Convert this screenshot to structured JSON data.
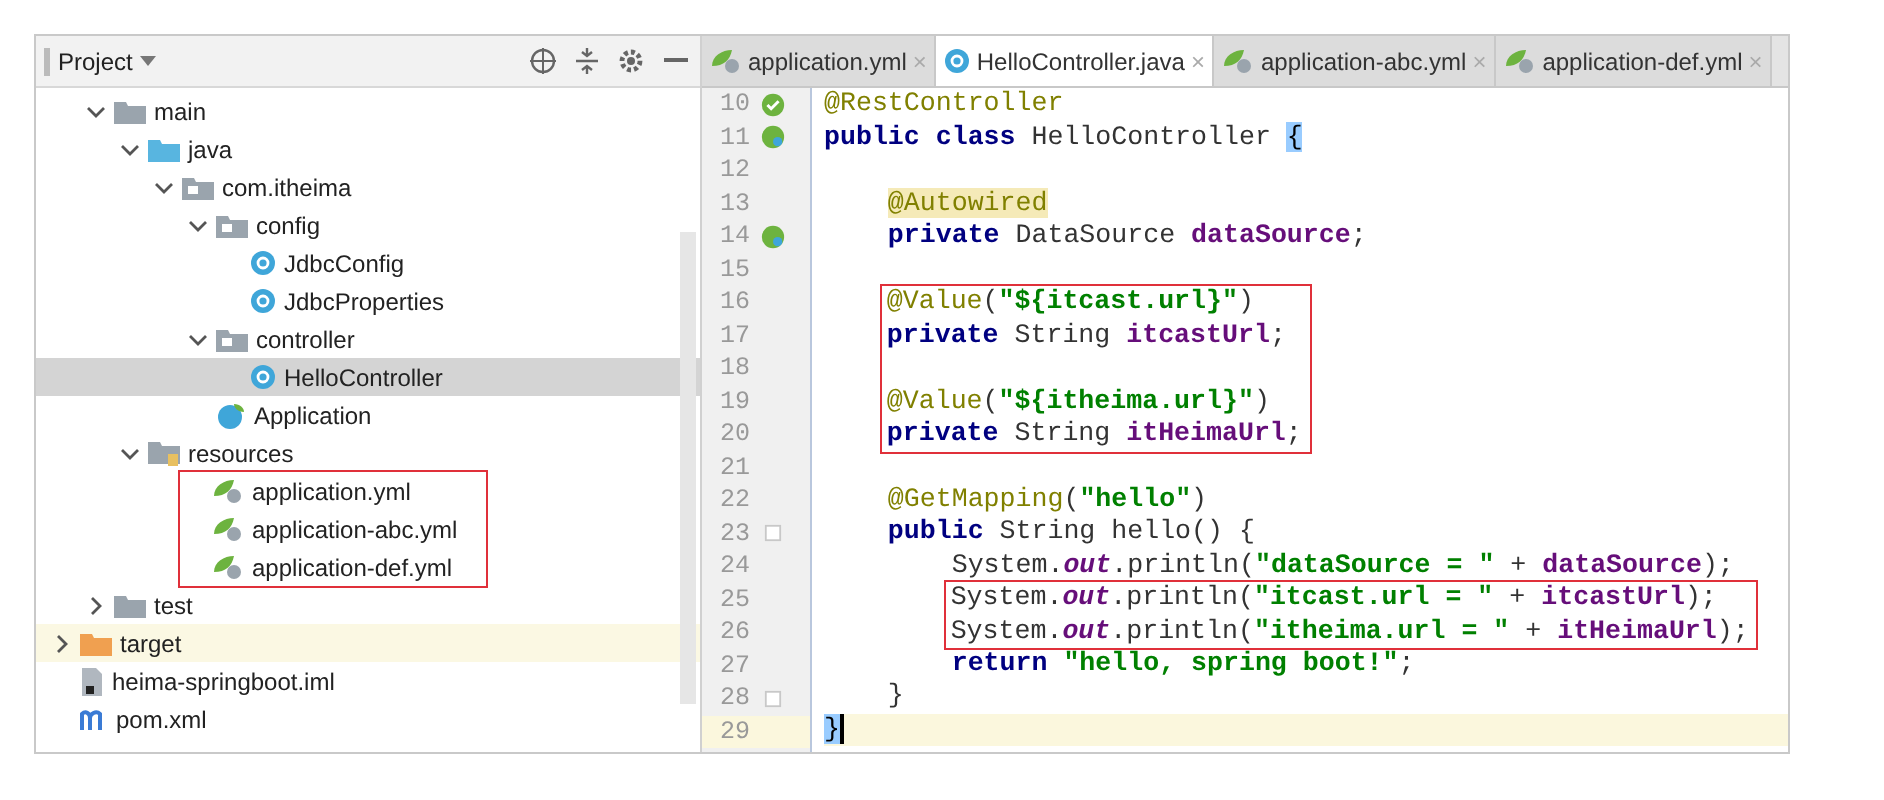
{
  "project_panel": {
    "title": "Project",
    "nested_items": [
      {
        "label": "main",
        "kind": "folder",
        "expanded": true,
        "selected": false,
        "children": [
          {
            "label": "java",
            "kind": "source-folder",
            "expanded": true,
            "selected": false,
            "children": [
              {
                "label": "com.itheima",
                "kind": "package",
                "expanded": true,
                "selected": false,
                "children": [
                  {
                    "label": "config",
                    "kind": "package",
                    "expanded": true,
                    "selected": false,
                    "children": [
                      {
                        "label": "JdbcConfig",
                        "kind": "class",
                        "selected": false
                      },
                      {
                        "label": "JdbcProperties",
                        "kind": "class",
                        "selected": false
                      }
                    ]
                  },
                  {
                    "label": "controller",
                    "kind": "package",
                    "expanded": true,
                    "selected": false,
                    "children": [
                      {
                        "label": "HelloController",
                        "kind": "class",
                        "selected": true
                      }
                    ]
                  },
                  {
                    "label": "Application",
                    "kind": "spring-class",
                    "selected": false
                  }
                ]
              }
            ]
          },
          {
            "label": "resources",
            "kind": "resources-folder",
            "expanded": true,
            "selected": false,
            "children": [
              {
                "kind": "box",
                "children": [
                  {
                    "label": "application.yml",
                    "kind": "yml",
                    "selected": false
                  },
                  {
                    "label": "application-abc.yml",
                    "kind": "yml",
                    "selected": false
                  },
                  {
                    "label": "application-def.yml",
                    "kind": "yml",
                    "selected": false
                  }
                ]
              }
            ]
          }
        ]
      },
      {
        "label": "test",
        "kind": "folder",
        "expanded": false,
        "selected": false
      }
    ],
    "items": [
      {
        "label": "target",
        "kind": "excluded-folder",
        "expanded": false,
        "selected": false
      },
      {
        "label": "heima-springboot.iml",
        "kind": "iml",
        "selected": false
      },
      {
        "label": "pom.xml",
        "kind": "maven",
        "selected": false
      }
    ]
  },
  "tabs": [
    {
      "label": "application.yml",
      "kind": "yml",
      "selected": false
    },
    {
      "label": "HelloController.java",
      "kind": "class",
      "selected": true
    },
    {
      "label": "application-abc.yml",
      "kind": "yml",
      "selected": false
    },
    {
      "label": "application-def.yml",
      "kind": "yml",
      "selected": false
    }
  ],
  "close_glyph": "×",
  "editor": {
    "lines": [
      {
        "no": "10",
        "kind": "bean-check",
        "current": false,
        "tokens": [
          {
            "kind": "ann",
            "text": "@RestController"
          }
        ]
      },
      {
        "no": "11",
        "kind": "bean",
        "current": false,
        "tokens": [
          {
            "kind": "kw",
            "text": "public class "
          },
          {
            "kind": "plain",
            "text": "HelloController "
          },
          {
            "kind": "brace",
            "text": "{"
          }
        ]
      },
      {
        "no": "12",
        "current": false
      },
      {
        "no": "13",
        "current": false,
        "tokens": [
          {
            "kind": "ann-hl",
            "text": "    @Autowired"
          }
        ]
      },
      {
        "no": "14",
        "kind": "bean",
        "current": false,
        "tokens": [
          {
            "kind": "kw",
            "text": "    private "
          },
          {
            "kind": "plain",
            "text": "DataSource "
          },
          {
            "kind": "field",
            "text": "dataSource"
          },
          {
            "kind": "plain",
            "text": ";"
          }
        ]
      },
      {
        "no": "15",
        "current": false
      },
      {
        "kind": "box",
        "lines": [
          {
            "no": "16",
            "current": false,
            "tokens": [
              {
                "kind": "ann",
                "text": "    @Value"
              },
              {
                "kind": "plain",
                "text": "("
              },
              {
                "kind": "str",
                "text": "\"${itcast.url}\""
              },
              {
                "kind": "plain",
                "text": ")"
              }
            ]
          },
          {
            "no": "17",
            "current": false,
            "tokens": [
              {
                "kind": "kw",
                "text": "    private "
              },
              {
                "kind": "plain",
                "text": "String "
              },
              {
                "kind": "field",
                "text": "itcastUrl"
              },
              {
                "kind": "plain",
                "text": ";"
              }
            ]
          },
          {
            "no": "18",
            "current": false
          },
          {
            "no": "19",
            "current": false,
            "tokens": [
              {
                "kind": "ann",
                "text": "    @Value"
              },
              {
                "kind": "plain",
                "text": "("
              },
              {
                "kind": "str",
                "text": "\"${itheima.url}\""
              },
              {
                "kind": "plain",
                "text": ")"
              }
            ]
          },
          {
            "no": "20",
            "current": false,
            "tokens": [
              {
                "kind": "kw",
                "text": "    private "
              },
              {
                "kind": "plain",
                "text": "String "
              },
              {
                "kind": "field",
                "text": "itHeimaUrl"
              },
              {
                "kind": "plain",
                "text": ";"
              }
            ]
          }
        ]
      },
      {
        "no": "21",
        "current": false
      },
      {
        "no": "22",
        "current": false,
        "tokens": [
          {
            "kind": "ann",
            "text": "    @GetMapping"
          },
          {
            "kind": "plain",
            "text": "("
          },
          {
            "kind": "str",
            "text": "\"hello\""
          },
          {
            "kind": "plain",
            "text": ")"
          }
        ]
      },
      {
        "no": "23",
        "kind": "fold",
        "current": false,
        "tokens": [
          {
            "kind": "kw",
            "text": "    public "
          },
          {
            "kind": "plain",
            "text": "String hello() {"
          }
        ]
      },
      {
        "no": "24",
        "current": false,
        "tokens": [
          {
            "kind": "plain",
            "text": "        System."
          },
          {
            "kind": "static",
            "text": "out"
          },
          {
            "kind": "plain",
            "text": ".println("
          },
          {
            "kind": "str",
            "text": "\"dataSource = \""
          },
          {
            "kind": "plain",
            "text": " + "
          },
          {
            "kind": "field",
            "text": "dataSource"
          },
          {
            "kind": "plain",
            "text": ");"
          }
        ]
      },
      {
        "kind": "box",
        "lines": [
          {
            "no": "25",
            "current": false,
            "tokens": [
              {
                "kind": "plain",
                "text": "        System."
              },
              {
                "kind": "static",
                "text": "out"
              },
              {
                "kind": "plain",
                "text": ".println("
              },
              {
                "kind": "str",
                "text": "\"itcast.url = \""
              },
              {
                "kind": "plain",
                "text": " + "
              },
              {
                "kind": "field",
                "text": "itcastUrl"
              },
              {
                "kind": "plain",
                "text": ");"
              }
            ]
          },
          {
            "no": "26",
            "current": false,
            "tokens": [
              {
                "kind": "plain",
                "text": "        System."
              },
              {
                "kind": "static",
                "text": "out"
              },
              {
                "kind": "plain",
                "text": ".println("
              },
              {
                "kind": "str",
                "text": "\"itheima.url = \""
              },
              {
                "kind": "plain",
                "text": " + "
              },
              {
                "kind": "field",
                "text": "itHeimaUrl"
              },
              {
                "kind": "plain",
                "text": ");"
              }
            ]
          }
        ]
      },
      {
        "no": "27",
        "current": false,
        "tokens": [
          {
            "kind": "kw",
            "text": "        return "
          },
          {
            "kind": "str",
            "text": "\"hello, spring boot!\""
          },
          {
            "kind": "plain",
            "text": ";"
          }
        ]
      },
      {
        "no": "28",
        "kind": "fold",
        "current": false,
        "tokens": [
          {
            "kind": "plain",
            "text": "    }"
          }
        ]
      },
      {
        "no": "29",
        "current": true,
        "tokens": [
          {
            "kind": "brace",
            "text": "}"
          }
        ]
      }
    ]
  }
}
